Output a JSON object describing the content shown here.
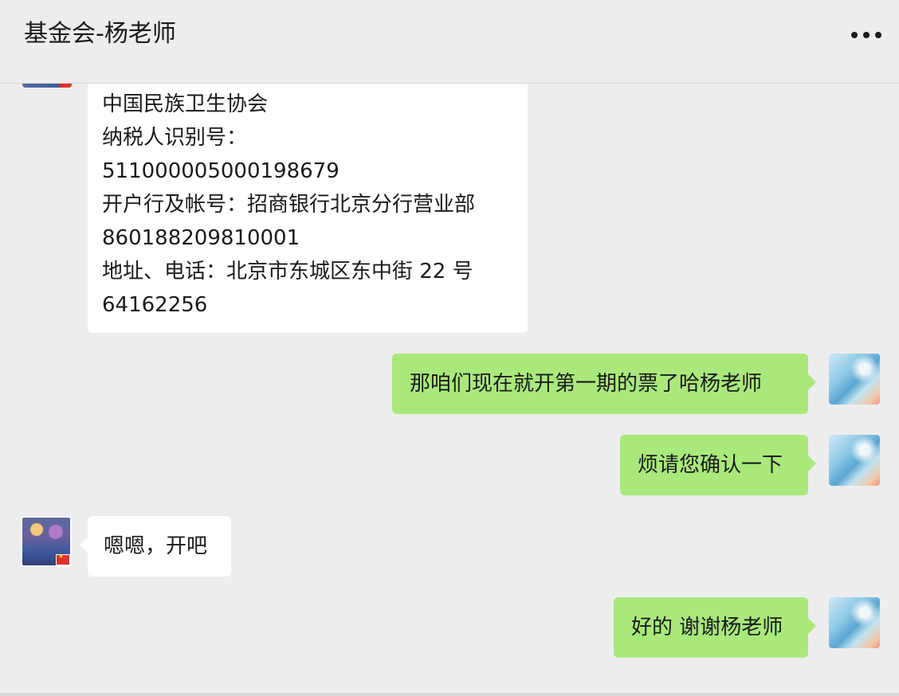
{
  "header": {
    "title": "基金会-杨老师",
    "more_icon": "more-horizontal-icon"
  },
  "messages": [
    {
      "sender": "contact",
      "lines": [
        "中国民族卫生协会",
        "纳税人识别号：",
        "51100000500019867​9",
        "开户行及帐号：招商银行北京分行营业部",
        "860188209810001",
        "地址、电话：北京市东城区东中街 22 号",
        "64162256"
      ]
    },
    {
      "sender": "me",
      "text": "那咱们现在就开第一期的票了哈杨老师"
    },
    {
      "sender": "me",
      "text": "烦请您确认一下"
    },
    {
      "sender": "contact",
      "text": "嗯嗯，开吧"
    },
    {
      "sender": "me",
      "text": "好的 谢谢杨老师"
    }
  ],
  "colors": {
    "background": "#ededed",
    "bubble_out": "#a9e97c",
    "bubble_in": "#ffffff"
  }
}
